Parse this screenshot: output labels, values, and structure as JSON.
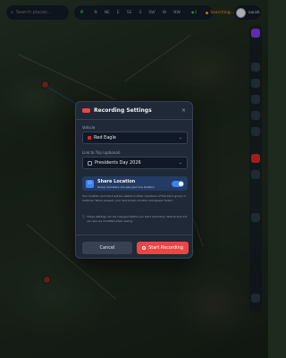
{
  "search": {
    "placeholder": "Search places..."
  },
  "toolbar": {
    "mode": "P",
    "directions": [
      "N",
      "NE",
      "E",
      "SE",
      "S",
      "SW",
      "W",
      "NW"
    ],
    "layers_label": "4",
    "status": "Searching..."
  },
  "user": {
    "name": "sarah"
  },
  "modal": {
    "title": "Recording Settings",
    "close_label": "×",
    "vehicle_label": "Vehicle",
    "vehicle_value": "Red Eagle",
    "trip_label": "Link to Trip (optional)",
    "trip_value": "Presidents Day 2026",
    "share_title": "Share Location",
    "share_subtitle": "Group members can see your live location",
    "share_help": "Your location and track will be visible to other members of this trip's group in realtime. When paused, your last known location will appear faded.",
    "note": "These settings can be changed before you start recording. Vehicle and trip can also be modified when saving.",
    "cancel_label": "Cancel",
    "start_label": "Start Recording"
  },
  "colors": {
    "accent": "#3b82f6",
    "danger": "#ef4444",
    "panel": "#1f2937"
  }
}
